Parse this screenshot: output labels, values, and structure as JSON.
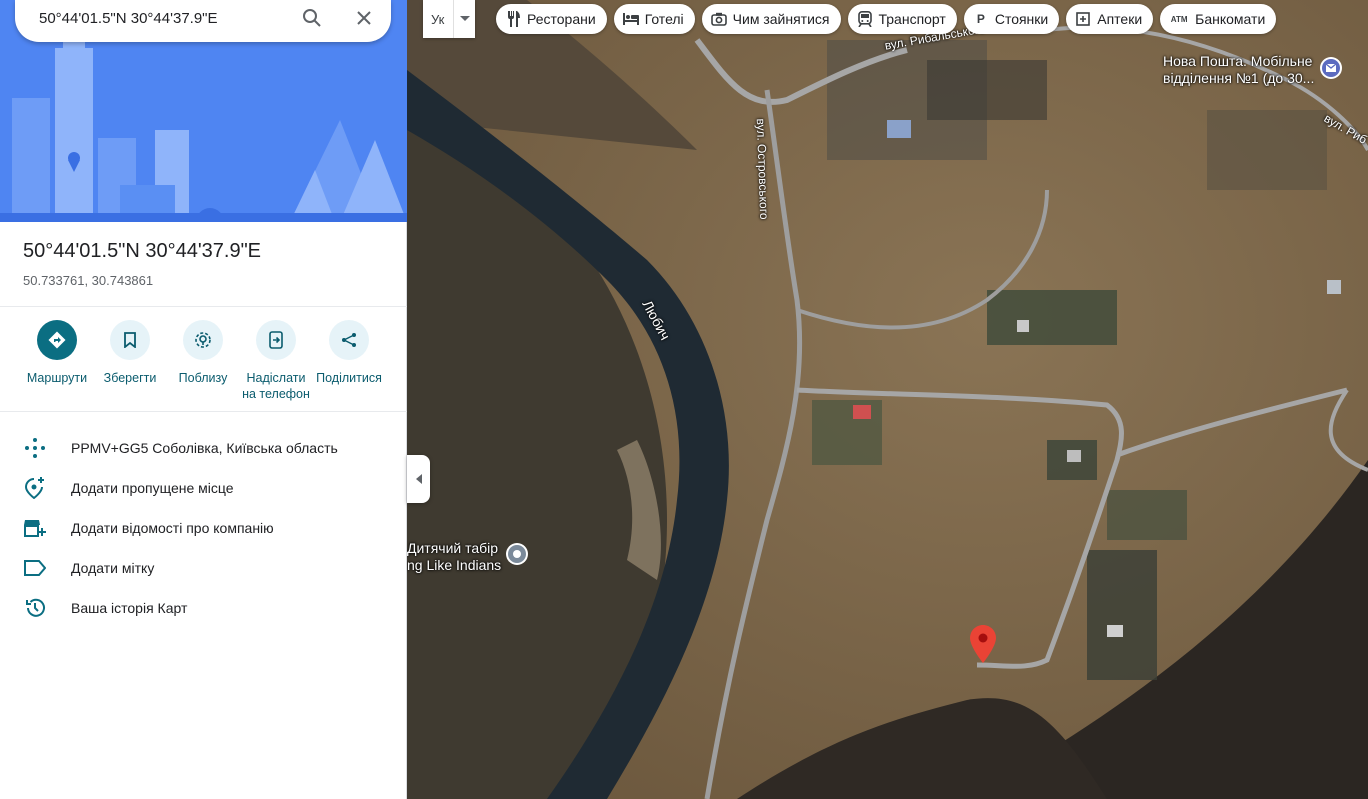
{
  "search": {
    "value": "50°44'01.5\"N 30°44'37.9\"E",
    "search_icon": "search-icon",
    "clear_icon": "close-icon"
  },
  "place": {
    "title": "50°44'01.5\"N 30°44'37.9\"E",
    "decimal": "50.733761, 30.743861"
  },
  "actions": [
    {
      "label": "Маршрути",
      "icon": "directions-icon"
    },
    {
      "label": "Зберегти",
      "icon": "bookmark-icon"
    },
    {
      "label": "Поблизу",
      "icon": "nearby-icon"
    },
    {
      "label": "Надіслати на телефон",
      "icon": "send-to-phone-icon"
    },
    {
      "label": "Поділитися",
      "icon": "share-icon"
    }
  ],
  "details": [
    {
      "text": "PPMV+GG5 Соболівка, Київська область",
      "icon": "plus-code-icon"
    },
    {
      "text": "Додати пропущене місце",
      "icon": "add-location-icon"
    },
    {
      "text": "Додати відомості про компанію",
      "icon": "add-business-icon"
    },
    {
      "text": "Додати мітку",
      "icon": "label-icon"
    },
    {
      "text": "Ваша історія Карт",
      "icon": "history-icon"
    }
  ],
  "map": {
    "layer_button": "Ук",
    "chips": [
      {
        "label": "Ресторани",
        "icon": "restaurant-icon"
      },
      {
        "label": "Готелі",
        "icon": "hotel-icon"
      },
      {
        "label": "Чим зайнятися",
        "icon": "camera-icon"
      },
      {
        "label": "Транспорт",
        "icon": "transit-icon"
      },
      {
        "label": "Стоянки",
        "icon": "parking-icon"
      },
      {
        "label": "Аптеки",
        "icon": "pharmacy-icon"
      },
      {
        "label": "Банкомати",
        "icon": "atm-icon"
      }
    ],
    "labels": {
      "river": "Любич",
      "street_ostrovskogo": "вул. Островського",
      "street_rybalskogo": "вул. Рибальського",
      "street_ryb2": "вул. Риб",
      "post_office": "Нова Пошта. Мобільне відділення №1 (до 30...",
      "camp": "Дитячий табір",
      "camp2": "ng Like Indians"
    }
  },
  "colors": {
    "accent": "#0b6e82",
    "hero": "#4a7fef",
    "pin": "#ea4335"
  }
}
